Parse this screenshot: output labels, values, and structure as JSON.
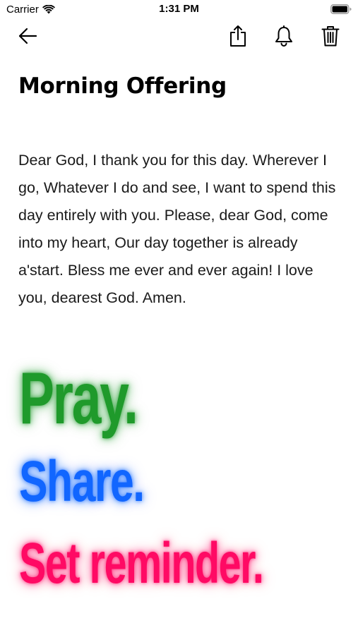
{
  "status_bar": {
    "carrier": "Carrier",
    "time": "1:31 PM"
  },
  "nav": {
    "back_icon": "arrow-left-icon",
    "share_icon": "share-icon",
    "reminder_icon": "bell-icon",
    "delete_icon": "trash-icon"
  },
  "prayer": {
    "title": "Morning Offering",
    "body": "Dear God, I thank you for this day. Wherever I go, Whatever I do and see, I want to spend this day entirely with you. Please, dear God, come into my heart, Our day together is already a'start. Bless me ever and ever again! I love you, dearest God. Amen."
  },
  "promo": {
    "pray": "Pray.",
    "share": "Share.",
    "reminder": "Set reminder.",
    "pray_color": "#1f9a2b",
    "share_color": "#1166ff",
    "reminder_color": "#ff0a64"
  }
}
